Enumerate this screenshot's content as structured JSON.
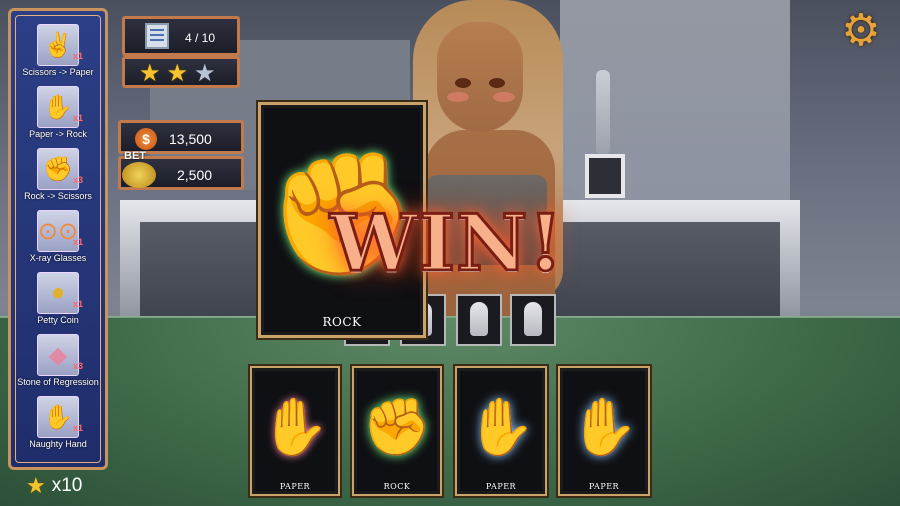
{
  "items": [
    {
      "label": "Scissors -> Paper",
      "count": "x1",
      "icon": "scissors-to-paper-icon"
    },
    {
      "label": "Paper -> Rock",
      "count": "x1",
      "icon": "paper-to-rock-icon"
    },
    {
      "label": "Rock -> Scissors",
      "count": "x3",
      "icon": "rock-to-scissors-icon"
    },
    {
      "label": "X-ray Glasses",
      "count": "x1",
      "icon": "xray-glasses-icon"
    },
    {
      "label": "Petty Coin",
      "count": "x1",
      "icon": "petty-coin-icon"
    },
    {
      "label": "Stone of Regression",
      "count": "x3",
      "icon": "stone-icon"
    },
    {
      "label": "Naughty Hand",
      "count": "x1",
      "icon": "naughty-hand-icon"
    }
  ],
  "star_total": "x10",
  "stage": {
    "progress": "4 / 10",
    "stars_earned": 2,
    "stars_total": 3
  },
  "coins": {
    "symbol": "$",
    "value": "13,500"
  },
  "bet": {
    "label": "BET",
    "value": "2,500"
  },
  "result_text": "WIN!",
  "opponent_card": {
    "label": "ROCK",
    "hand": "rock",
    "color": "#4fe06c"
  },
  "player_cards": [
    {
      "label": "PAPER",
      "hand": "paper-red",
      "color": "#e05a7a"
    },
    {
      "label": "ROCK",
      "hand": "rock",
      "color": "#4fe06c"
    },
    {
      "label": "PAPER",
      "hand": "paper",
      "color": "#5aa7ff"
    },
    {
      "label": "PAPER",
      "hand": "paper",
      "color": "#5aa7ff"
    }
  ],
  "colors": {
    "panel_border": "#c9935e",
    "felt": "#3f6b4a",
    "gear": "#e8a23a"
  }
}
